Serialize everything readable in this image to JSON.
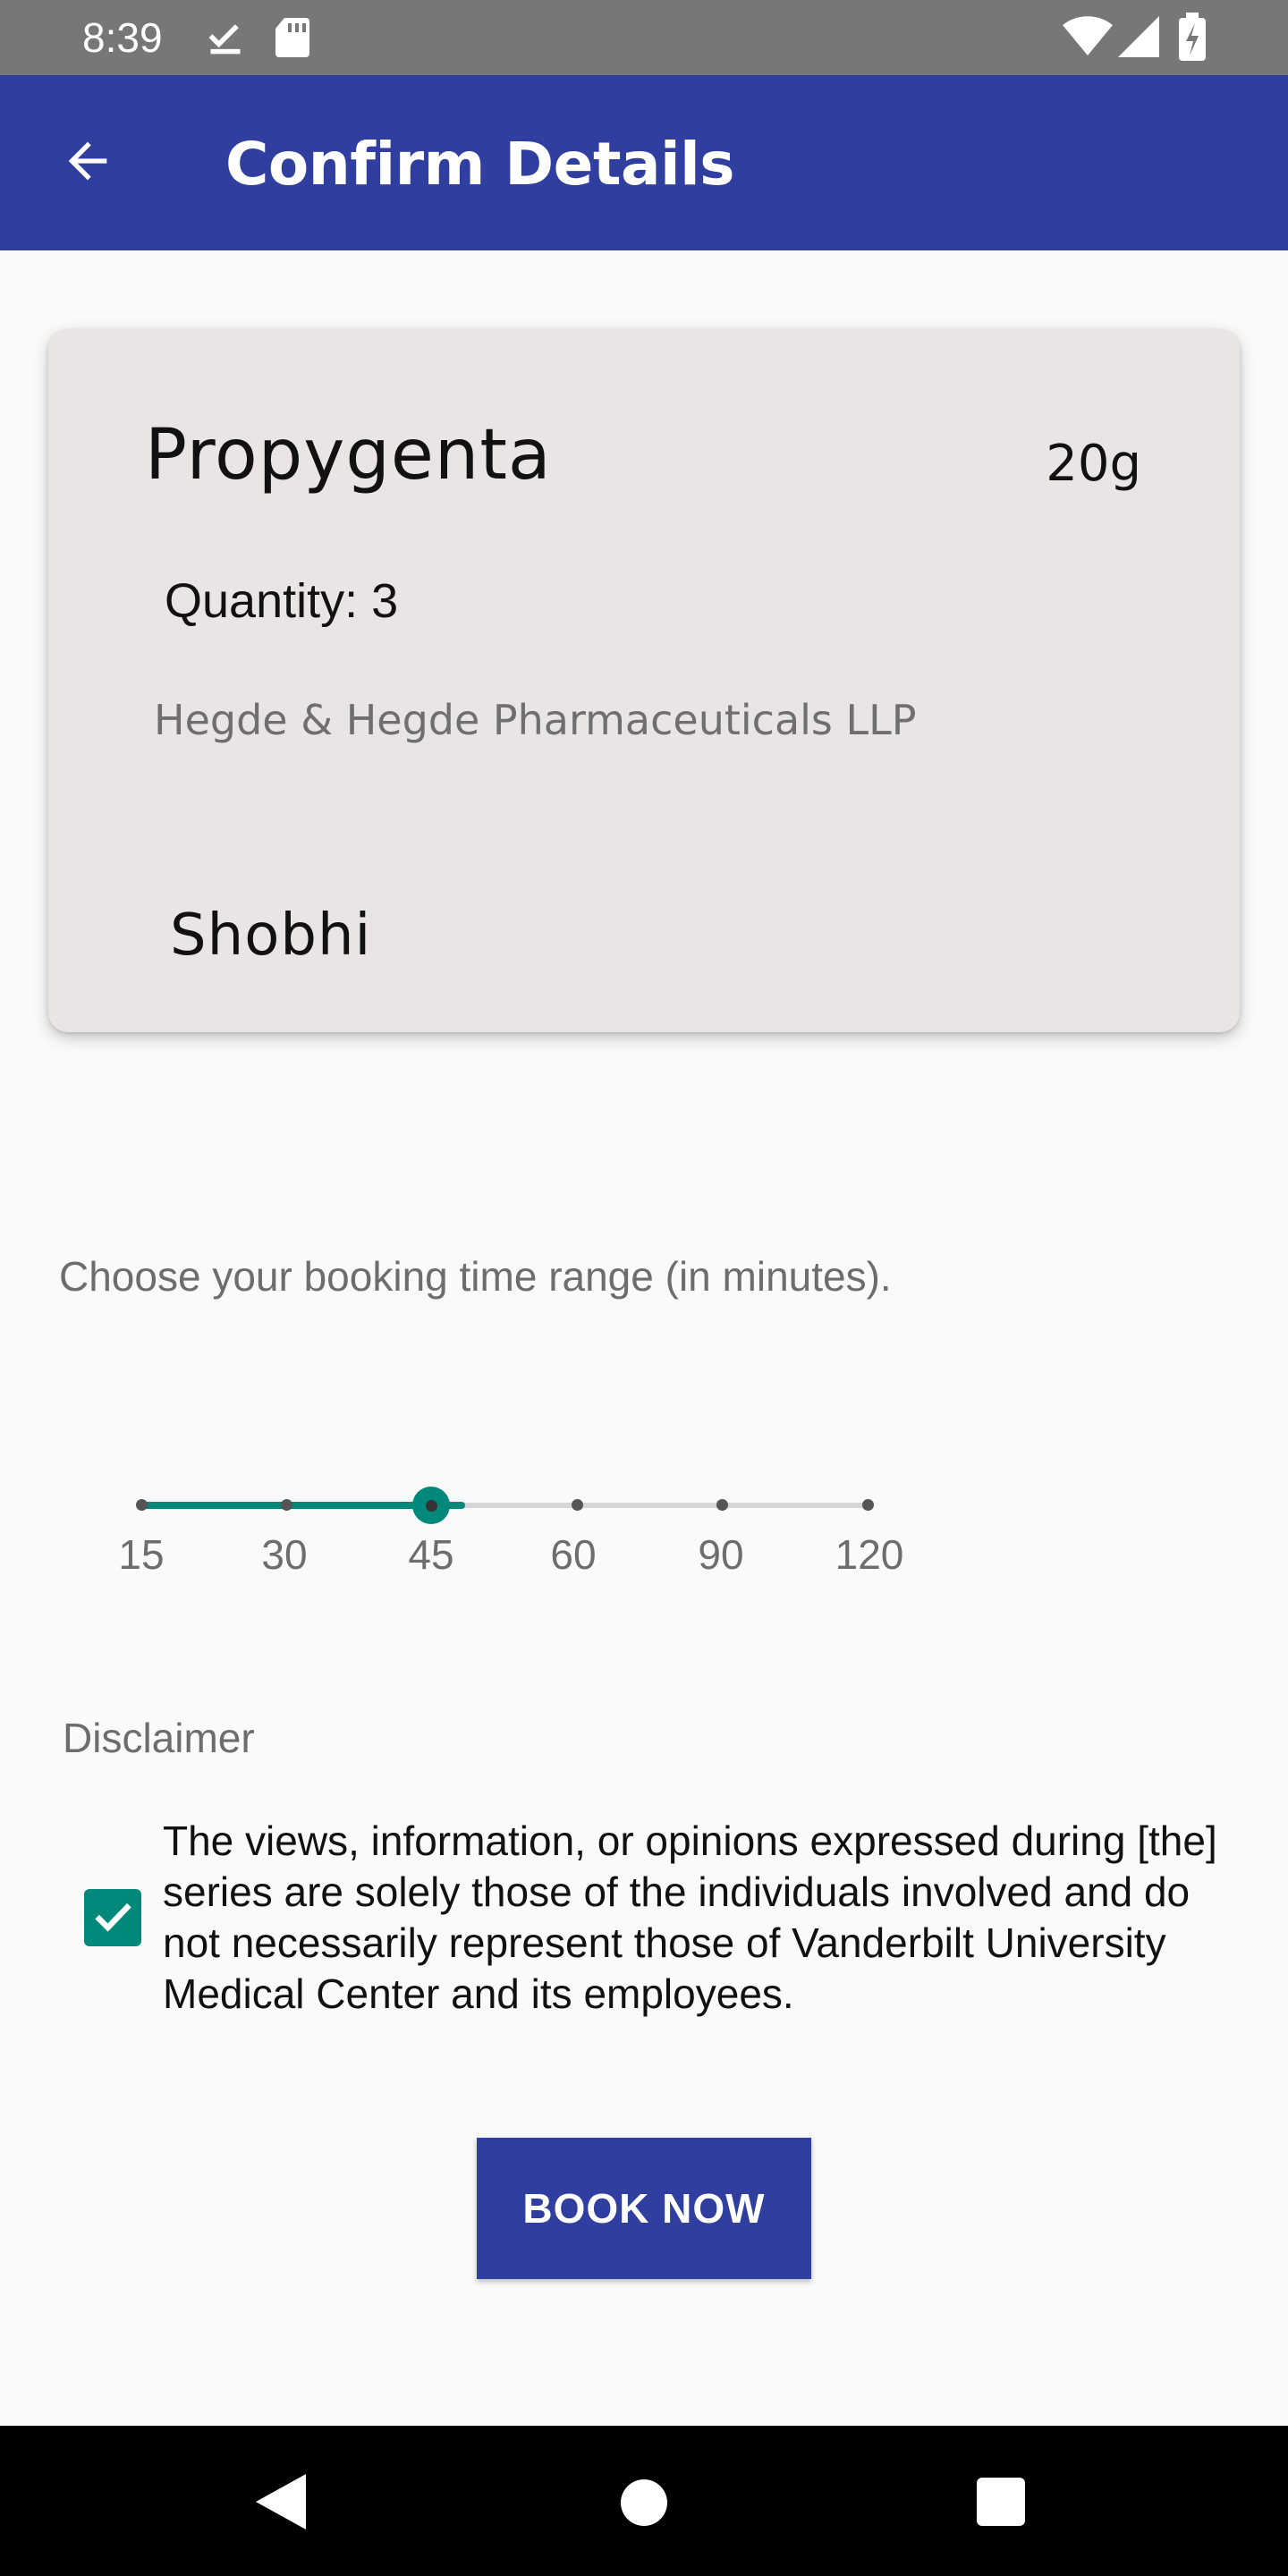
{
  "status_bar": {
    "time": "8:39",
    "icons": [
      "download-done-icon",
      "sd-card-icon",
      "wifi-icon",
      "signal-icon",
      "battery-charging-icon"
    ]
  },
  "app_bar": {
    "title": "Confirm Details",
    "back_icon": "arrow-back-icon",
    "color": "#303f9f"
  },
  "card": {
    "product_name": "Propygenta",
    "size": "20g",
    "quantity": "Quantity: 3",
    "manufacturer": "Hegde & Hegde Pharmaceuticals LLP",
    "seller": "Shobhi"
  },
  "booking": {
    "label": "Choose your booking time range (in minutes).",
    "options": [
      "15",
      "30",
      "45",
      "60",
      "90",
      "120"
    ],
    "selected": "45",
    "accent": "#00897b"
  },
  "disclaimer": {
    "title": "Disclaimer",
    "checked": true,
    "text": "The views, information, or opinions expressed during [the] series are solely those of the individuals involved and do not necessarily represent those of Vanderbilt University Medical Center and its employees."
  },
  "actions": {
    "book_label": "BOOK NOW"
  },
  "nav_bar": {
    "icons": [
      "back-triangle-icon",
      "home-circle-icon",
      "recents-square-icon"
    ]
  }
}
